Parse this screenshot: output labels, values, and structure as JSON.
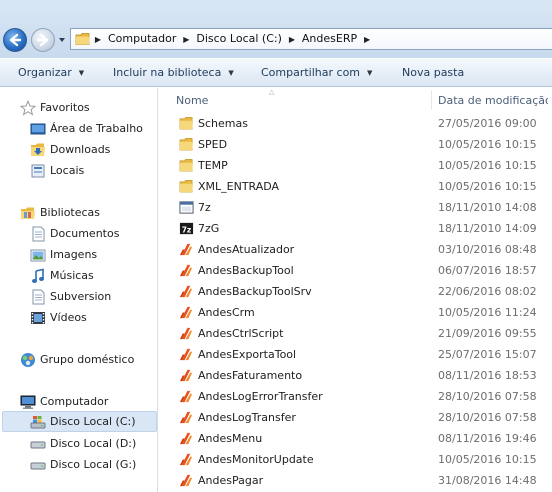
{
  "address_bar": {
    "breadcrumbs": [
      "Computador",
      "Disco Local (C:)",
      "AndesERP"
    ]
  },
  "toolbar": {
    "organize": "Organizar",
    "include_library": "Incluir na biblioteca",
    "share_with": "Compartilhar com",
    "new_folder": "Nova pasta"
  },
  "nav": {
    "favorites": {
      "label": "Favoritos",
      "items": [
        "Área de Trabalho",
        "Downloads",
        "Locais"
      ]
    },
    "libraries": {
      "label": "Bibliotecas",
      "items": [
        "Documentos",
        "Imagens",
        "Músicas",
        "Subversion",
        "Vídeos"
      ]
    },
    "homegroup": {
      "label": "Grupo doméstico"
    },
    "computer": {
      "label": "Computador",
      "items": [
        "Disco Local (C:)",
        "Disco Local (D:)",
        "Disco Local (G:)"
      ],
      "selected": "Disco Local (C:)"
    }
  },
  "columns": {
    "name": "Nome",
    "date": "Data de modificação"
  },
  "files": [
    {
      "name": "Schemas",
      "date": "27/05/2016 09:00",
      "icon": "folder-icon"
    },
    {
      "name": "SPED",
      "date": "10/05/2016 10:15",
      "icon": "folder-icon"
    },
    {
      "name": "TEMP",
      "date": "10/05/2016 10:15",
      "icon": "folder-icon"
    },
    {
      "name": "XML_ENTRADA",
      "date": "10/05/2016 10:15",
      "icon": "folder-icon"
    },
    {
      "name": "7z",
      "date": "18/11/2010 14:08",
      "icon": "console-app-icon"
    },
    {
      "name": "7zG",
      "date": "18/11/2010 14:09",
      "icon": "7z-app-icon"
    },
    {
      "name": "AndesAtualizador",
      "date": "03/10/2016 08:48",
      "icon": "andes-app-icon"
    },
    {
      "name": "AndesBackupTool",
      "date": "06/07/2016 18:57",
      "icon": "andes-app-icon"
    },
    {
      "name": "AndesBackupToolSrv",
      "date": "22/06/2016 08:02",
      "icon": "andes-app-icon"
    },
    {
      "name": "AndesCrm",
      "date": "10/05/2016 11:24",
      "icon": "andes-app-icon"
    },
    {
      "name": "AndesCtrlScript",
      "date": "21/09/2016 09:55",
      "icon": "andes-app-icon"
    },
    {
      "name": "AndesExportaTool",
      "date": "25/07/2016 15:07",
      "icon": "andes-app-icon"
    },
    {
      "name": "AndesFaturamento",
      "date": "08/11/2016 18:53",
      "icon": "andes-app-icon"
    },
    {
      "name": "AndesLogErrorTransfer",
      "date": "28/10/2016 07:58",
      "icon": "andes-app-icon"
    },
    {
      "name": "AndesLogTransfer",
      "date": "28/10/2016 07:58",
      "icon": "andes-app-icon"
    },
    {
      "name": "AndesMenu",
      "date": "08/11/2016 19:46",
      "icon": "andes-app-icon"
    },
    {
      "name": "AndesMonitorUpdate",
      "date": "10/05/2016 10:15",
      "icon": "andes-app-icon"
    },
    {
      "name": "AndesPagar",
      "date": "31/08/2016 14:48",
      "icon": "andes-app-icon"
    }
  ],
  "colors": {
    "address_gradient_top": "#d9e7f5",
    "selection": "#d9e6f6",
    "header_text": "#4c607a",
    "date_text": "#6d6d6d",
    "folder": "#f1c95a",
    "andes_icon": "#e8501c"
  }
}
